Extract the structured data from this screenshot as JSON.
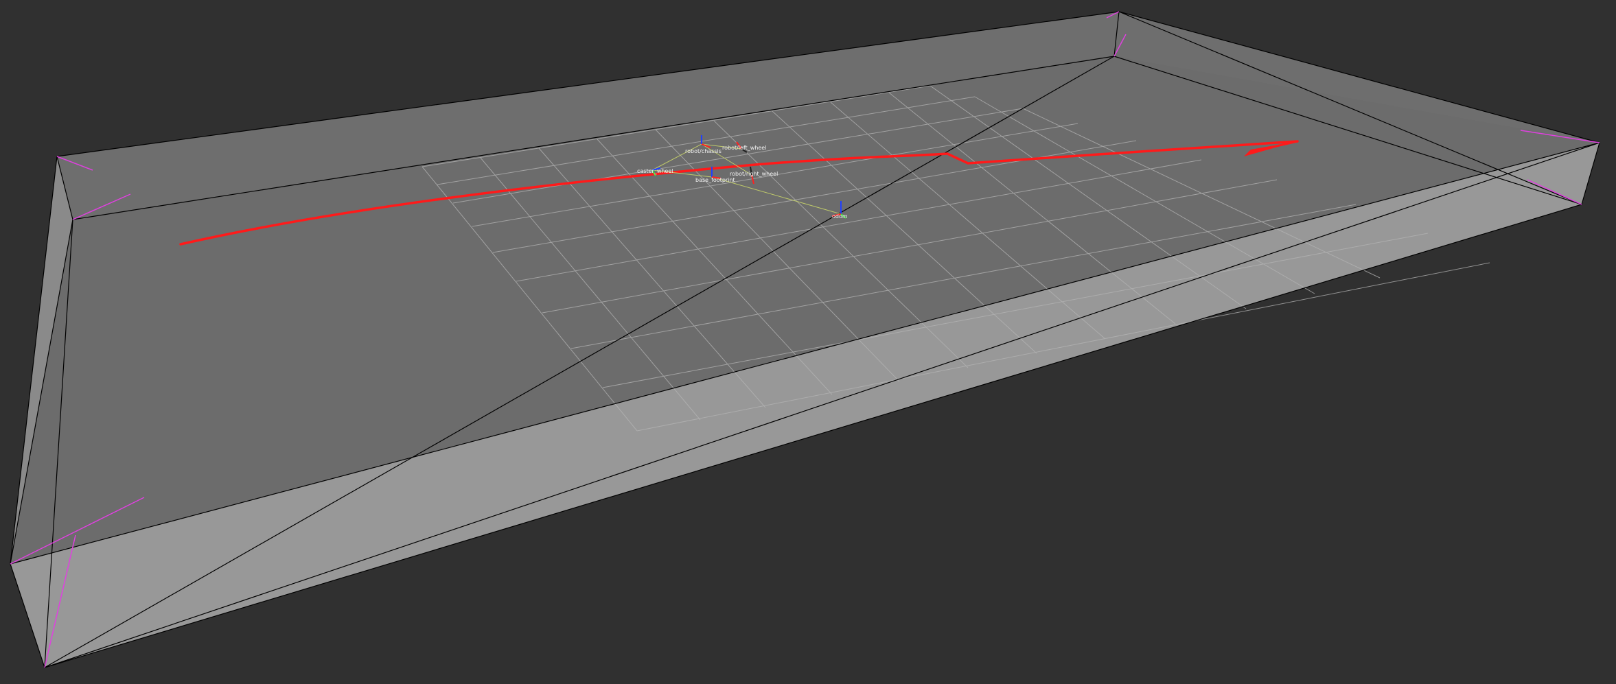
{
  "viewport": {
    "background_color": "#303030",
    "grid_color": "#b4b4b4",
    "path_color": "#ff1a1a",
    "map_top_color": "#6c6c6c",
    "map_side_color": "#9a9a9a",
    "map_edge_color": "#000000",
    "map_marker_color": "#e040e0"
  },
  "tf_frames": [
    {
      "name": "robot/chassis"
    },
    {
      "name": "robot/left_wheel"
    },
    {
      "name": "robot/right_wheel"
    },
    {
      "name": "caster_wheel"
    },
    {
      "name": "base_footprint"
    },
    {
      "name": "odom"
    }
  ]
}
